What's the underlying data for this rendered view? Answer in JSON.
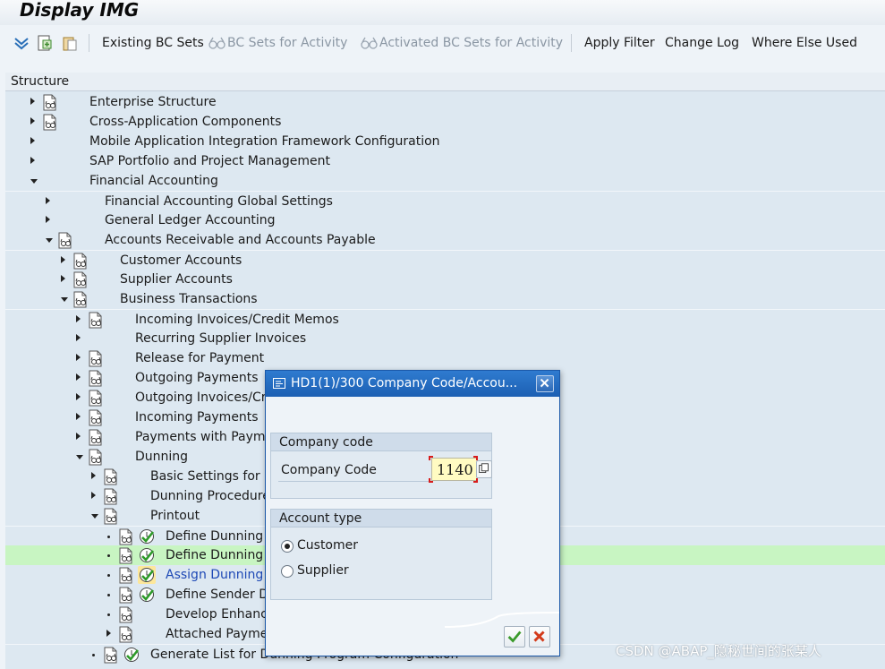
{
  "title": "Display IMG",
  "toolbar": {
    "existing_bc_sets": "Existing BC Sets",
    "bc_sets_activity": "BC Sets for Activity",
    "activated_bc_sets": "Activated BC Sets for Activity",
    "apply_filter": "Apply Filter",
    "change_log": "Change Log",
    "where_else_used": "Where Else Used"
  },
  "tree": {
    "header": "Structure",
    "rows": [
      {
        "label": "Enterprise Structure"
      },
      {
        "label": "Cross-Application Components"
      },
      {
        "label": "Mobile Application Integration Framework Configuration"
      },
      {
        "label": "SAP Portfolio and Project Management"
      },
      {
        "label": "Financial Accounting"
      },
      {
        "label": "Financial Accounting Global Settings"
      },
      {
        "label": "General Ledger Accounting"
      },
      {
        "label": "Accounts Receivable and Accounts Payable"
      },
      {
        "label": "Customer Accounts"
      },
      {
        "label": "Supplier Accounts"
      },
      {
        "label": "Business Transactions"
      },
      {
        "label": "Incoming Invoices/Credit Memos"
      },
      {
        "label": "Recurring Supplier Invoices"
      },
      {
        "label": "Release for Payment"
      },
      {
        "label": "Outgoing Payments"
      },
      {
        "label": "Outgoing Invoices/Cre"
      },
      {
        "label": "Incoming Payments"
      },
      {
        "label": "Payments with Payme"
      },
      {
        "label": "Dunning"
      },
      {
        "label": "Basic Settings for D"
      },
      {
        "label": "Dunning Procedure"
      },
      {
        "label": "Printout"
      },
      {
        "label": "Define Dunning F"
      },
      {
        "label": "Define Dunning F"
      },
      {
        "label": "Assign Dunning F"
      },
      {
        "label": "Define Sender De"
      },
      {
        "label": "Develop Enhance"
      },
      {
        "label": "Attached Paymer"
      },
      {
        "label": "Generate List for Dunning Program Configuration"
      }
    ]
  },
  "dialog": {
    "title": "HD1(1)/300 Company Code/Accou...",
    "company_group": "Company code",
    "company_label": "Company Code",
    "company_value": "1140",
    "account_group": "Account type",
    "customer_label": "Customer",
    "supplier_label": "Supplier",
    "selected_account_type": "Customer"
  },
  "watermark": "CSDN @ABAP_隐秘世间的张某人"
}
